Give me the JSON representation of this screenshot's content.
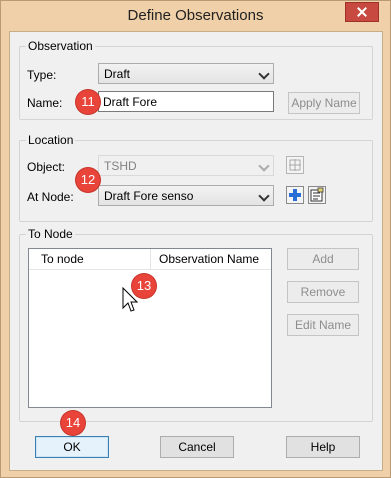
{
  "window": {
    "title": "Define Observations"
  },
  "observation": {
    "group_label": "Observation",
    "type_label": "Type:",
    "type_value": "Draft",
    "name_label": "Name:",
    "name_value": "Draft Fore",
    "apply_name_label": "Apply Name"
  },
  "location": {
    "group_label": "Location",
    "object_label": "Object:",
    "object_value": "TSHD",
    "at_node_label": "At Node:",
    "at_node_value": "Draft Fore senso"
  },
  "to_node": {
    "group_label": "To Node",
    "columns": [
      "To node",
      "Observation Name"
    ],
    "rows": [],
    "add_label": "Add",
    "remove_label": "Remove",
    "edit_name_label": "Edit Name"
  },
  "footer": {
    "ok_label": "OK",
    "cancel_label": "Cancel",
    "help_label": "Help"
  },
  "callouts": [
    "11",
    "12",
    "13",
    "14"
  ],
  "colors": {
    "callout": "#e8443a",
    "frame": "#f0d0a8",
    "dialog_bg": "#f0f0f0"
  }
}
